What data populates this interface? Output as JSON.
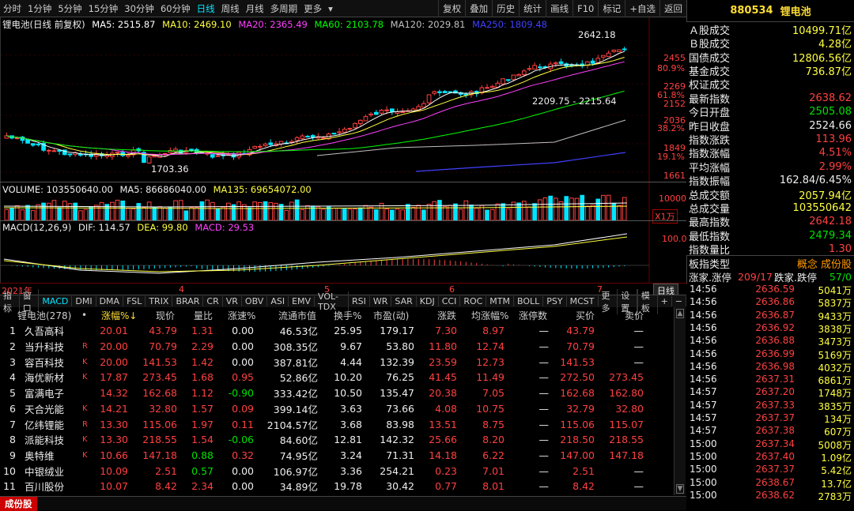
{
  "toolbar": {
    "periods": [
      "分时",
      "1分钟",
      "5分钟",
      "15分钟",
      "30分钟",
      "60分钟",
      "日线",
      "周线",
      "月线",
      "多周期",
      "更多"
    ],
    "active_period": "日线",
    "tools": [
      "复权",
      "叠加",
      "历史",
      "统计",
      "画线",
      "F10",
      "标记",
      "+自选",
      "返回"
    ]
  },
  "right_title": {
    "code": "880534",
    "name": "锂电池"
  },
  "kline": {
    "title": "锂电池(日线 前复权)",
    "ma": [
      {
        "label": "MA5: 2515.87",
        "color": "#ffffff"
      },
      {
        "label": "MA10: 2469.10",
        "color": "#ffff40"
      },
      {
        "label": "MA20: 2365.49",
        "color": "#ff40ff"
      },
      {
        "label": "MA60: 2103.78",
        "color": "#00ff00"
      },
      {
        "label": "MA120: 2029.81",
        "color": "#c0c0c0"
      },
      {
        "label": "MA250: 1809.48",
        "color": "#4040ff"
      }
    ],
    "price_labels": [
      "2455",
      "80.9%",
      "2269",
      "61.8%",
      "2152",
      "2036",
      "38.2%",
      "1849",
      "19.1%",
      "1661"
    ],
    "annot_high": "2642.18",
    "annot_low": "1703.36",
    "annot_range": "2209.75 - 2215.64",
    "x_labels": [
      "2021年",
      "4",
      "5",
      "6",
      "7"
    ]
  },
  "volume": {
    "label": "VOLUME: 103550640.00",
    "ma5": "MA5: 86686040.00",
    "ma135": "MA135: 69654072.00",
    "scale": "10000",
    "unit": "X1万"
  },
  "macd": {
    "label": "MACD(12,26,9)",
    "dif": "DIF: 114.57",
    "dea": "DEA: 99.80",
    "macd": "MACD: 29.53",
    "scale": "100.0",
    "panel_btn": "日线"
  },
  "indicators": [
    "指标",
    "窗口",
    "MACD",
    "DMI",
    "DMA",
    "FSL",
    "TRIX",
    "BRAR",
    "CR",
    "VR",
    "OBV",
    "ASI",
    "EMV",
    "VOL-TDX",
    "RSI",
    "WR",
    "SAR",
    "KDJ",
    "CCI",
    "ROC",
    "MTM",
    "BOLL",
    "PSY",
    "MCST",
    "更多",
    "设置"
  ],
  "indicator_selected": "MACD",
  "sort_btn": "模板",
  "table": {
    "header": [
      "锂电池(278)",
      "•",
      "涨幅%↓",
      "现价",
      "量比",
      "涨速%",
      "流通市值",
      "换手%",
      "市盈(动)",
      "涨跌",
      "均涨幅%",
      "涨停数",
      "买价",
      "卖价"
    ],
    "rows": [
      [
        "1",
        "久吾高科",
        "",
        "20.01",
        "43.79",
        "1.31",
        "0.00",
        "46.53亿",
        "25.95",
        "179.17",
        "7.30",
        "8.97",
        "—",
        "43.79",
        "—"
      ],
      [
        "2",
        "当升科技",
        "R",
        "20.00",
        "70.79",
        "2.29",
        "0.00",
        "308.35亿",
        "9.67",
        "53.80",
        "11.80",
        "12.74",
        "—",
        "70.79",
        "—"
      ],
      [
        "3",
        "容百科技",
        "K",
        "20.00",
        "141.53",
        "1.42",
        "0.00",
        "387.81亿",
        "4.44",
        "132.39",
        "23.59",
        "12.73",
        "—",
        "141.53",
        "—"
      ],
      [
        "4",
        "海优新材",
        "K",
        "17.87",
        "273.45",
        "1.68",
        "0.95",
        "52.86亿",
        "10.20",
        "76.25",
        "41.45",
        "11.49",
        "—",
        "272.50",
        "273.45"
      ],
      [
        "5",
        "富满电子",
        "",
        "14.32",
        "162.68",
        "1.12",
        "-0.90",
        "333.42亿",
        "10.50",
        "135.47",
        "20.38",
        "7.05",
        "—",
        "162.68",
        "162.80"
      ],
      [
        "6",
        "天合光能",
        "K",
        "14.21",
        "32.80",
        "1.57",
        "0.09",
        "399.14亿",
        "3.63",
        "73.66",
        "4.08",
        "10.75",
        "—",
        "32.79",
        "32.80"
      ],
      [
        "7",
        "亿纬锂能",
        "R",
        "13.30",
        "115.06",
        "1.97",
        "0.11",
        "2104.57亿",
        "3.68",
        "83.98",
        "13.51",
        "8.75",
        "—",
        "115.06",
        "115.07"
      ],
      [
        "8",
        "派能科技",
        "K",
        "13.30",
        "218.55",
        "1.54",
        "-0.06",
        "84.60亿",
        "12.81",
        "142.32",
        "25.66",
        "8.20",
        "—",
        "218.50",
        "218.55"
      ],
      [
        "9",
        "奥特维",
        "K",
        "10.66",
        "147.18",
        "0.88",
        "0.32",
        "74.95亿",
        "3.24",
        "71.31",
        "14.18",
        "6.22",
        "—",
        "147.00",
        "147.18"
      ],
      [
        "10",
        "中银绒业",
        "",
        "10.09",
        "2.51",
        "0.57",
        "0.00",
        "106.97亿",
        "3.36",
        "254.21",
        "0.23",
        "7.01",
        "—",
        "2.51",
        "—"
      ],
      [
        "11",
        "百川股份",
        "",
        "10.07",
        "8.42",
        "2.34",
        "0.00",
        "34.89亿",
        "19.78",
        "30.42",
        "0.77",
        "8.01",
        "—",
        "8.42",
        "—"
      ]
    ]
  },
  "info": [
    {
      "label": "Ａ股成交",
      "value": "10499.71亿",
      "color": "#ffff40"
    },
    {
      "label": "Ｂ股成交",
      "value": "4.28亿",
      "color": "#ffff40"
    },
    {
      "label": "国债成交",
      "value": "12806.56亿",
      "color": "#ffff40"
    },
    {
      "label": "基金成交",
      "value": "736.87亿",
      "color": "#ffff40"
    },
    {
      "label": "权证成交",
      "value": "",
      "color": "#ffff40"
    },
    {
      "label": "最新指数",
      "value": "2638.62",
      "color": "#ff4040"
    },
    {
      "label": "今日开盘",
      "value": "2505.08",
      "color": "#00e000"
    },
    {
      "label": "昨日收盘",
      "value": "2524.66",
      "color": "#eeeeee"
    },
    {
      "label": "指数涨跌",
      "value": "113.96",
      "color": "#ff4040"
    },
    {
      "label": "指数涨幅",
      "value": "4.51%",
      "color": "#ff4040"
    },
    {
      "label": "平均涨幅",
      "value": "2.99%",
      "color": "#ff4040"
    },
    {
      "label": "指数振幅",
      "value": "162.84/6.45%",
      "color": "#eeeeee"
    },
    {
      "label": "总成交额",
      "value": "2057.94亿",
      "color": "#ffff40"
    },
    {
      "label": "总成交量",
      "value": "103550642",
      "color": "#ffff40"
    },
    {
      "label": "最高指数",
      "value": "2642.18",
      "color": "#ff4040"
    },
    {
      "label": "最低指数",
      "value": "2479.34",
      "color": "#00e000"
    },
    {
      "label": "指数量比",
      "value": "1.30",
      "color": "#ff4040"
    }
  ],
  "sector_type": {
    "label": "板指类型",
    "value": "概念 成份股"
  },
  "limit_row": {
    "l1": "涨家.涨停",
    "v1": "209/17",
    "l2": "跌家.跌停",
    "v2": "57/0"
  },
  "ticks": [
    [
      "14:56",
      "2636.59",
      "5041万"
    ],
    [
      "14:56",
      "2636.86",
      "5837万"
    ],
    [
      "14:56",
      "2636.87",
      "9433万"
    ],
    [
      "14:56",
      "2636.92",
      "3838万"
    ],
    [
      "14:56",
      "2636.88",
      "3473万"
    ],
    [
      "14:56",
      "2636.99",
      "5169万"
    ],
    [
      "14:56",
      "2636.98",
      "4032万"
    ],
    [
      "14:56",
      "2637.31",
      "6861万"
    ],
    [
      "14:57",
      "2637.20",
      "1748万"
    ],
    [
      "14:57",
      "2637.33",
      "3835万"
    ],
    [
      "14:57",
      "2637.37",
      "134万"
    ],
    [
      "14:57",
      "2637.38",
      "607万"
    ],
    [
      "15:00",
      "2637.34",
      "5008万"
    ],
    [
      "15:00",
      "2637.40",
      "1.09亿"
    ],
    [
      "15:00",
      "2637.37",
      "5.42亿"
    ],
    [
      "15:00",
      "2638.67",
      "13.7亿"
    ],
    [
      "15:00",
      "2638.62",
      "2783万"
    ]
  ],
  "bottom": {
    "tag": "成份股"
  },
  "colors": {
    "up": "#ff4040",
    "down": "#00e5ff",
    "bg": "#000000"
  }
}
